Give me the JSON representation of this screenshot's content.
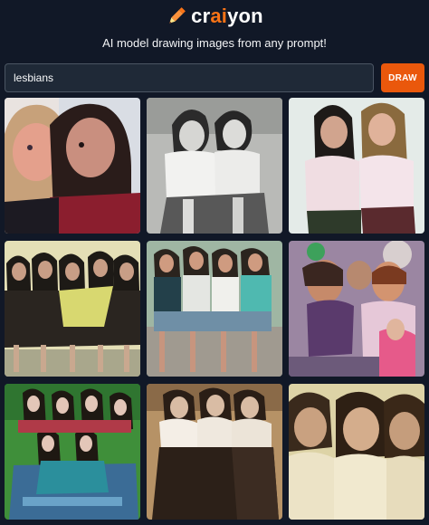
{
  "app": {
    "logo_prefix": "cr",
    "logo_accent": "ai",
    "logo_suffix": "yon",
    "tagline": "AI model drawing images from any prompt!",
    "accent_color": "#ea580c"
  },
  "search": {
    "value": "lesbians",
    "button_label": "DRAW"
  },
  "gallery": {
    "tile_count": 9,
    "icons": [
      "pencil-icon"
    ]
  }
}
